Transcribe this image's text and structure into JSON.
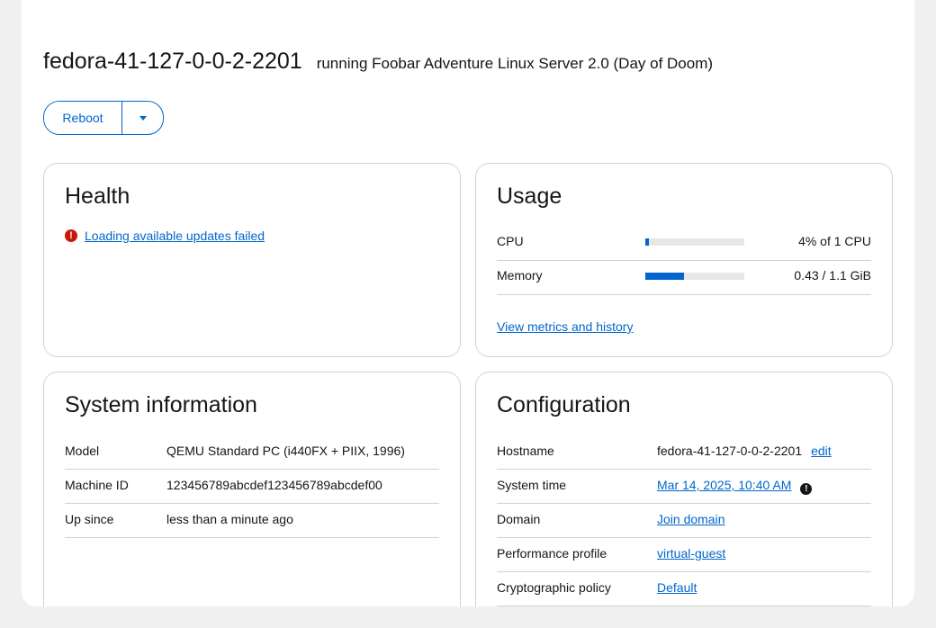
{
  "header": {
    "hostname": "fedora-41-127-0-0-2-2201",
    "os": "running Foobar Adventure Linux Server 2.0 (Day of Doom)"
  },
  "actions": {
    "reboot_label": "Reboot",
    "dropdown_icon": "caret-down-icon"
  },
  "health": {
    "title": "Health",
    "alert_text": "Loading available updates failed",
    "alert_icon": "exclamation-circle-icon",
    "alert_color": "#c9190b"
  },
  "usage": {
    "title": "Usage",
    "rows": [
      {
        "label": "CPU",
        "fraction": 0.04,
        "value": "4% of 1 CPU"
      },
      {
        "label": "Memory",
        "fraction": 0.39,
        "value": "0.43 / 1.1 GiB"
      }
    ],
    "metrics_link": "View metrics and history"
  },
  "system_info": {
    "title": "System information",
    "rows": [
      {
        "label": "Model",
        "value": "QEMU Standard PC (i440FX + PIIX, 1996)"
      },
      {
        "label": "Machine ID",
        "value": "123456789abcdef123456789abcdef00"
      },
      {
        "label": "Up since",
        "value": "less than a minute ago"
      }
    ]
  },
  "configuration": {
    "title": "Configuration",
    "rows": [
      {
        "label": "Hostname",
        "value": "fedora-41-127-0-0-2-2201",
        "action": "edit"
      },
      {
        "label": "System time",
        "value": "Mar 14, 2025, 10:40 AM",
        "icon": "info-icon"
      },
      {
        "label": "Domain",
        "value": "Join domain"
      },
      {
        "label": "Performance profile",
        "value": "virtual-guest"
      },
      {
        "label": "Cryptographic policy",
        "value": "Default"
      }
    ]
  },
  "colors": {
    "accent": "#0066cc",
    "background": "#f0f0f0",
    "border": "#d2d2d2"
  }
}
